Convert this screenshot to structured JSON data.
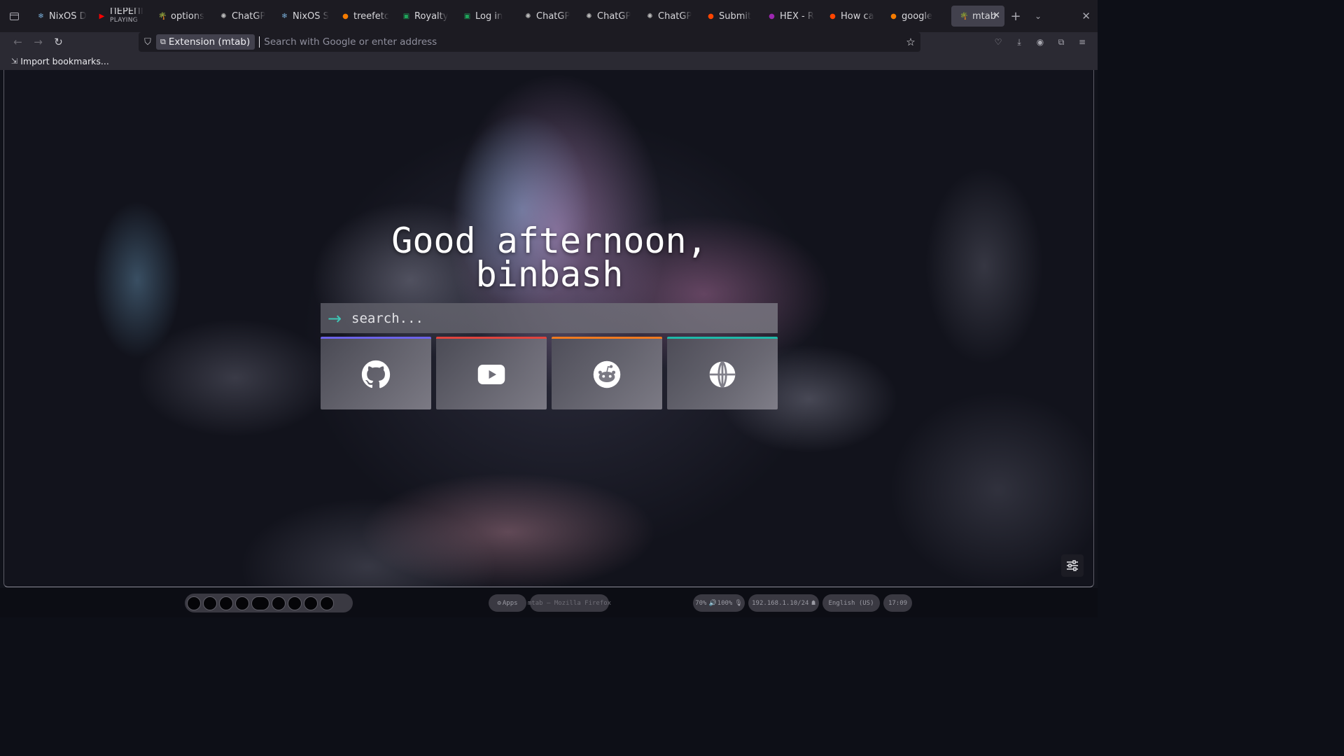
{
  "browser": {
    "tabs": [
      {
        "title": "NixOS D",
        "icon": "nixos-icon",
        "color": "#7ab1db"
      },
      {
        "title": "ПЕРЕПІ",
        "subtitle": "PLAYING",
        "icon": "youtube-icon",
        "color": "#ff0000"
      },
      {
        "title": "options",
        "icon": "palm-icon",
        "color": "#8bc34a"
      },
      {
        "title": "ChatGP",
        "icon": "chatgpt-icon",
        "color": "#bdbdbd"
      },
      {
        "title": "NixOS S",
        "icon": "nixos-icon",
        "color": "#7ab1db"
      },
      {
        "title": "treefetc",
        "icon": "firefox-icon",
        "color": "#f57c00"
      },
      {
        "title": "Royalty",
        "icon": "px-icon",
        "color": "#1fa45a"
      },
      {
        "title": "Log in",
        "icon": "px-icon",
        "color": "#1fa45a"
      },
      {
        "title": "ChatGP",
        "icon": "chatgpt-icon",
        "color": "#bdbdbd"
      },
      {
        "title": "ChatGP",
        "icon": "chatgpt-icon",
        "color": "#bdbdbd"
      },
      {
        "title": "ChatGP",
        "icon": "chatgpt-icon",
        "color": "#bdbdbd"
      },
      {
        "title": "Submit",
        "icon": "reddit-icon",
        "color": "#ff4500"
      },
      {
        "title": "HEX - R",
        "icon": "color-wheel-icon",
        "color": "#9c27b0"
      },
      {
        "title": "How ca",
        "icon": "reddit-icon",
        "color": "#ff4500"
      },
      {
        "title": "google",
        "icon": "firefox-icon",
        "color": "#f57c00"
      }
    ],
    "active_tab": {
      "title": "mtab",
      "icon": "palm-icon",
      "color": "#8bc34a"
    },
    "identity_label": "Extension (mtab)",
    "url_placeholder": "Search with Google or enter address",
    "bookmarks_import_label": "Import bookmarks..."
  },
  "page": {
    "greeting_line1": "Good afternoon,",
    "greeting_line2": "binbash",
    "search_placeholder": "search...",
    "search_arrow": "→",
    "accent": "#3ec7b6",
    "links": [
      {
        "name": "github",
        "icon": "github-icon",
        "accent": "#6c63e8"
      },
      {
        "name": "youtube",
        "icon": "youtube-icon",
        "accent": "#e0443e"
      },
      {
        "name": "reddit",
        "icon": "reddit-icon",
        "accent": "#f07a20"
      },
      {
        "name": "web",
        "icon": "globe-icon",
        "accent": "#1fb8a8"
      }
    ]
  },
  "statusbar": {
    "workspace_count": 10,
    "apps_label": "Apps",
    "window_title": "mtab — Mozilla Firefox",
    "volume": "70%",
    "volume_level": "100%",
    "network": "192.168.1.10/24",
    "language": "English (US)",
    "clock": "17:09"
  }
}
